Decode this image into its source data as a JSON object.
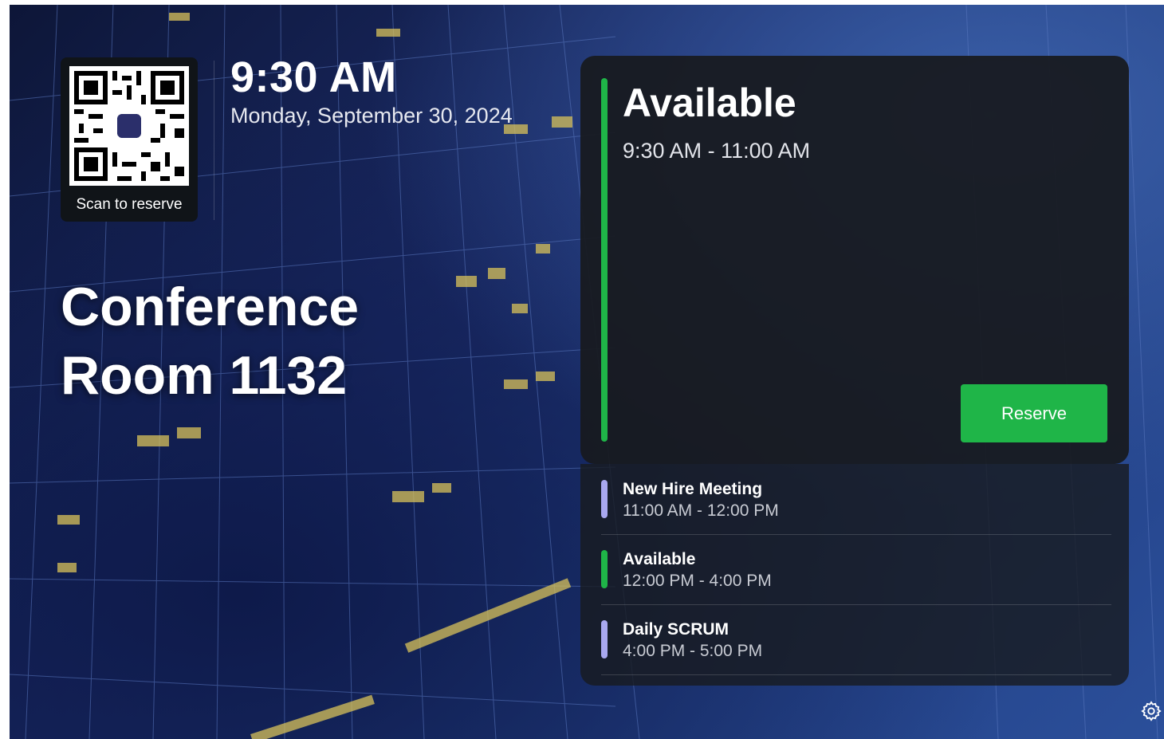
{
  "room": {
    "name_line1": "Conference",
    "name_line2": "Room 1132"
  },
  "clock": {
    "time": "9:30 AM",
    "date": "Monday, September 30, 2024"
  },
  "qr": {
    "label": "Scan to reserve",
    "icon": "teams-logo-icon"
  },
  "current_status": {
    "title": "Available",
    "time_range": "9:30 AM - 11:00 AM",
    "color": "#1fb548",
    "reserve_label": "Reserve"
  },
  "agenda": [
    {
      "title": "New Hire Meeting",
      "time": "11:00 AM - 12:00 PM",
      "color": "#a9a8f0"
    },
    {
      "title": "Available",
      "time": "12:00 PM - 4:00 PM",
      "color": "#1fb548"
    },
    {
      "title": "Daily SCRUM",
      "time": "4:00 PM - 5:00 PM",
      "color": "#a9a8f0"
    }
  ],
  "settings": {
    "icon": "gear-icon"
  }
}
